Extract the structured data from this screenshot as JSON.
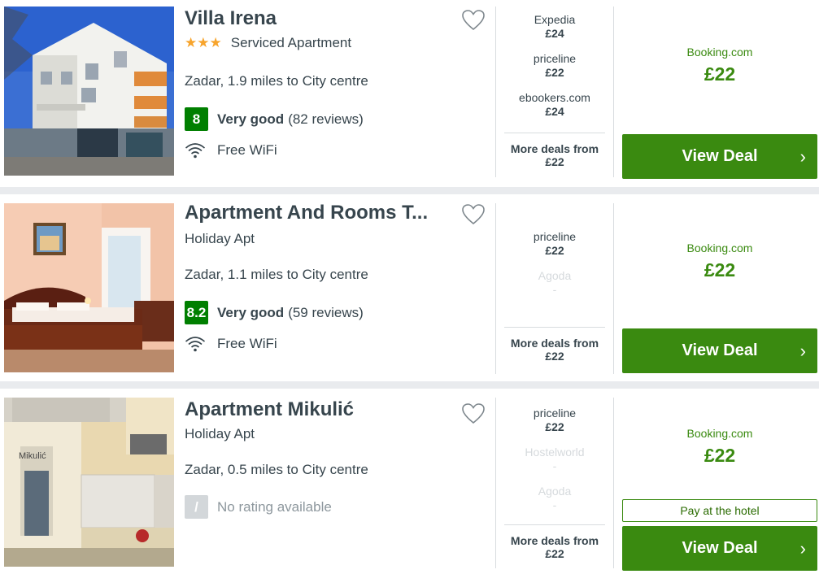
{
  "hotels": [
    {
      "name": "Villa Irena",
      "stars": "★★★",
      "type": "Serviced Apartment",
      "location": "Zadar, 1.9 miles to City centre",
      "rating_score": "8",
      "rating_label": "Very good",
      "reviews": "(82 reviews)",
      "amenity": "Free WiFi",
      "deals": [
        {
          "provider": "Expedia",
          "price": "£24"
        },
        {
          "provider": "priceline",
          "price": "£22"
        },
        {
          "provider": "ebookers.com",
          "price": "£24"
        }
      ],
      "more_deals_label": "More deals from",
      "more_deals_price": "£22",
      "main_provider": "Booking.com",
      "main_price": "£22",
      "cta_label": "View Deal"
    },
    {
      "name": "Apartment And Rooms T...",
      "type": "Holiday Apt",
      "location": "Zadar, 1.1 miles to City centre",
      "rating_score": "8.2",
      "rating_label": "Very good",
      "reviews": "(59 reviews)",
      "amenity": "Free WiFi",
      "deals": [
        {
          "provider": "priceline",
          "price": "£22"
        },
        {
          "provider": "Agoda",
          "price": "-"
        }
      ],
      "more_deals_label": "More deals from",
      "more_deals_price": "£22",
      "main_provider": "Booking.com",
      "main_price": "£22",
      "cta_label": "View Deal"
    },
    {
      "name": "Apartment Mikulić",
      "type": "Holiday Apt",
      "location": "Zadar, 0.5 miles to City centre",
      "rating_score": "/",
      "rating_label": "No rating available",
      "deals": [
        {
          "provider": "priceline",
          "price": "£22"
        },
        {
          "provider": "Hostelworld",
          "price": "-"
        },
        {
          "provider": "Agoda",
          "price": "-"
        }
      ],
      "more_deals_label": "More deals from",
      "more_deals_price": "£22",
      "main_provider": "Booking.com",
      "main_price": "£22",
      "pay_at_hotel": "Pay at the hotel",
      "cta_label": "View Deal",
      "photo_sign": "Mikulić"
    }
  ],
  "icons": {
    "favorite": "heart-icon",
    "wifi": "wifi-icon",
    "chevron": "chevron-right-icon"
  },
  "colors": {
    "accent_green": "#3a8a10",
    "rating_green": "#007f00",
    "star": "#f7a42c"
  }
}
